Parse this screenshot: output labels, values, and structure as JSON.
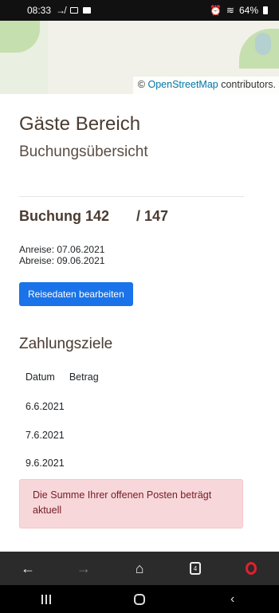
{
  "status_bar": {
    "time": "08:33",
    "battery": "64%"
  },
  "map": {
    "attribution_prefix": "©",
    "attribution_link": "OpenStreetMap",
    "attribution_suffix": "contributors."
  },
  "page": {
    "title": "Gäste Bereich",
    "subtitle": "Buchungsübersicht"
  },
  "booking": {
    "label": "Buchung 142",
    "total": "/ 147",
    "arrival": "Anreise: 07.06.2021",
    "departure": "Abreise: 09.06.2021",
    "edit_button": "Reisedaten bearbeiten"
  },
  "payments": {
    "title": "Zahlungsziele",
    "columns": [
      "Datum",
      "Betrag"
    ],
    "rows": [
      {
        "date": "6.6.2021"
      },
      {
        "date": "7.6.2021"
      },
      {
        "date": "9.6.2021"
      }
    ]
  },
  "alert": {
    "text": "Die Summe Ihrer offenen Posten beträgt aktuell"
  },
  "browser_toolbar": {
    "tab_count": "4"
  },
  "colors": {
    "primary_button": "#1a73e8",
    "alert_bg": "#f8d7da",
    "alert_text": "#721c24",
    "heading": "#4a3b31"
  }
}
